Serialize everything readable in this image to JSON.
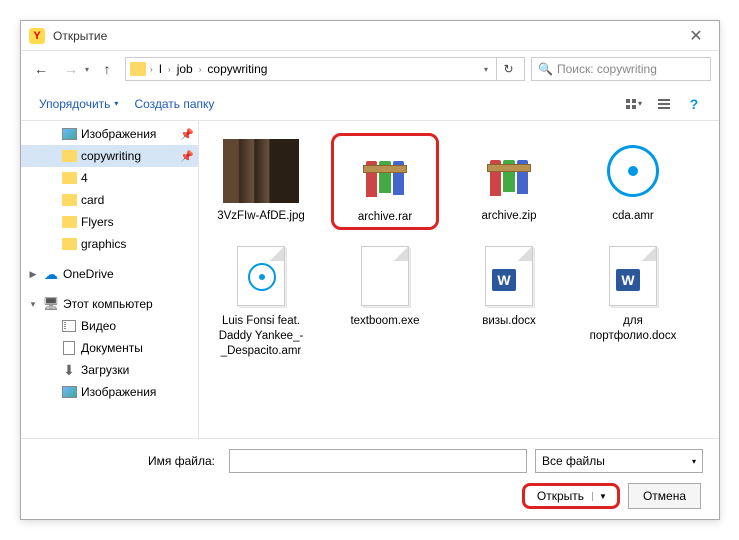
{
  "window": {
    "title": "Открытие"
  },
  "nav": {
    "path": [
      "I",
      "job",
      "copywriting"
    ],
    "search_placeholder": "Поиск: copywriting"
  },
  "toolbar": {
    "organize": "Упорядочить",
    "new_folder": "Создать папку"
  },
  "sidebar": [
    {
      "label": "Изображения",
      "icon": "pictures",
      "indent": 1,
      "pin": true
    },
    {
      "label": "copywriting",
      "icon": "folder",
      "indent": 1,
      "pin": true,
      "selected": true
    },
    {
      "label": "4",
      "icon": "folder",
      "indent": 1
    },
    {
      "label": "card",
      "icon": "folder",
      "indent": 1
    },
    {
      "label": "Flyers",
      "icon": "folder",
      "indent": 1
    },
    {
      "label": "graphics",
      "icon": "folder",
      "indent": 1
    },
    {
      "label": "",
      "icon": "gap"
    },
    {
      "label": "OneDrive",
      "icon": "cloud",
      "indent": 0,
      "exp": "▶"
    },
    {
      "label": "",
      "icon": "gap"
    },
    {
      "label": "Этот компьютер",
      "icon": "pc",
      "indent": 0,
      "exp": "▾"
    },
    {
      "label": "Видео",
      "icon": "video",
      "indent": 1
    },
    {
      "label": "Документы",
      "icon": "doc",
      "indent": 1
    },
    {
      "label": "Загрузки",
      "icon": "download",
      "indent": 1
    },
    {
      "label": "Изображения",
      "icon": "pictures",
      "indent": 1
    }
  ],
  "files": [
    {
      "name": "3VzFIw-AfDE.jpg",
      "type": "image"
    },
    {
      "name": "archive.rar",
      "type": "rar",
      "highlighted": true
    },
    {
      "name": "archive.zip",
      "type": "rar"
    },
    {
      "name": "cda.amr",
      "type": "disc"
    },
    {
      "name": "Luis Fonsi feat. Daddy Yankee_-_Despacito.amr",
      "type": "disc-page"
    },
    {
      "name": "textboom.exe",
      "type": "page"
    },
    {
      "name": "визы.docx",
      "type": "word"
    },
    {
      "name": "для портфолио.docx",
      "type": "word"
    }
  ],
  "footer": {
    "filename_label": "Имя файла:",
    "filename_value": "",
    "filter": "Все файлы",
    "open": "Открыть",
    "cancel": "Отмена"
  }
}
